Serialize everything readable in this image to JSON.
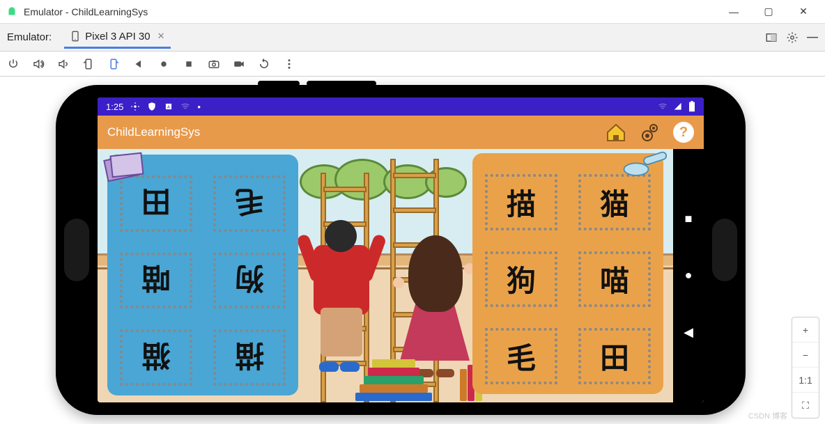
{
  "window": {
    "title": "Emulator - ChildLearningSys"
  },
  "tabstrip": {
    "label": "Emulator:",
    "device_tab": "Pixel 3 API 30"
  },
  "statusbar": {
    "time": "1:25"
  },
  "appbar": {
    "title": "ChildLearningSys",
    "help_label": "?"
  },
  "cards": {
    "left": [
      "田",
      "毛",
      "喵",
      "狗",
      "猫",
      "描"
    ],
    "right": [
      "描",
      "猫",
      "狗",
      "喵",
      "毛",
      "田"
    ]
  },
  "zoom": {
    "plus": "+",
    "minus": "−",
    "oneone": "1:1",
    "fit": "⛶"
  },
  "watermark": "CSDN 博客"
}
